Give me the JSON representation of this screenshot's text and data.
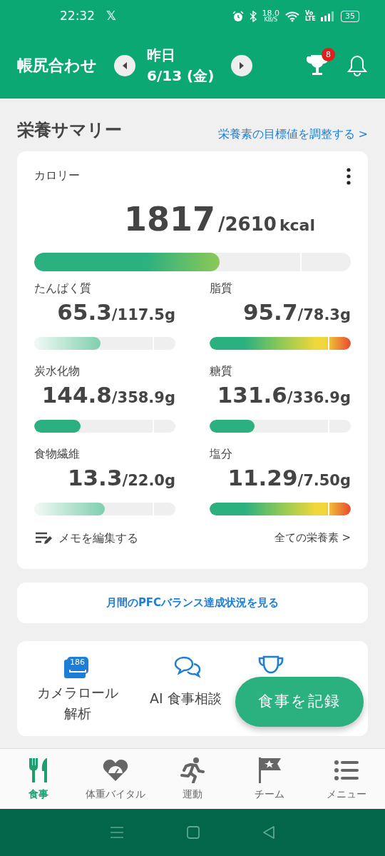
{
  "status_bar": {
    "time": "22:32",
    "app_glyph": "𝕏",
    "net_speed": "18.0",
    "net_unit": "KB/S",
    "volte": "Vo LTE",
    "battery": "35"
  },
  "header": {
    "title": "帳尻合わせ",
    "day": "昨日",
    "date": "6/13 (金)",
    "trophy_badge": "8"
  },
  "summary": {
    "title": "栄養サマリー",
    "adjust_link": "栄養素の目標値を調整する >"
  },
  "calorie": {
    "label": "カロリー",
    "value": "1817",
    "target": "/2610",
    "unit": "kcal",
    "level": 0.585
  },
  "nutrients": [
    {
      "name": "たんぱく質",
      "value": "65.3",
      "target": "/117.5g",
      "kind": "light",
      "level": 0.47
    },
    {
      "name": "脂質",
      "value": "95.7",
      "target": "/78.3g",
      "kind": "over",
      "level": 1
    },
    {
      "name": "炭水化物",
      "value": "144.8",
      "target": "/358.9g",
      "kind": "solid",
      "level": 0.33
    },
    {
      "name": "糖質",
      "value": "131.6",
      "target": "/336.9g",
      "kind": "solid",
      "level": 0.32
    },
    {
      "name": "食物繊維",
      "value": "13.3",
      "target": "/22.0g",
      "kind": "light",
      "level": 0.5
    },
    {
      "name": "塩分",
      "value": "11.29",
      "target": "/7.50g",
      "kind": "over",
      "level": 1
    }
  ],
  "memo_link": "メモを編集する",
  "all_nutrients_link": "全ての栄養素 >",
  "pfc_button": "月間のPFCバランス達成状況を見る",
  "shortcuts": [
    {
      "kind": "camera",
      "label": "カメラロール解析",
      "badge": "186"
    },
    {
      "kind": "chat",
      "label": "AI 食事相談"
    },
    {
      "kind": "trophy"
    }
  ],
  "fab": "食事を記録",
  "bottom_nav": [
    {
      "kind": "meal",
      "label": "食事",
      "selected": true
    },
    {
      "kind": "weight",
      "label": "体重バイタル",
      "selected": false
    },
    {
      "kind": "run",
      "label": "運動",
      "selected": false
    },
    {
      "kind": "team",
      "label": "チーム",
      "selected": false
    },
    {
      "kind": "menu",
      "label": "メニュー",
      "selected": false
    }
  ]
}
